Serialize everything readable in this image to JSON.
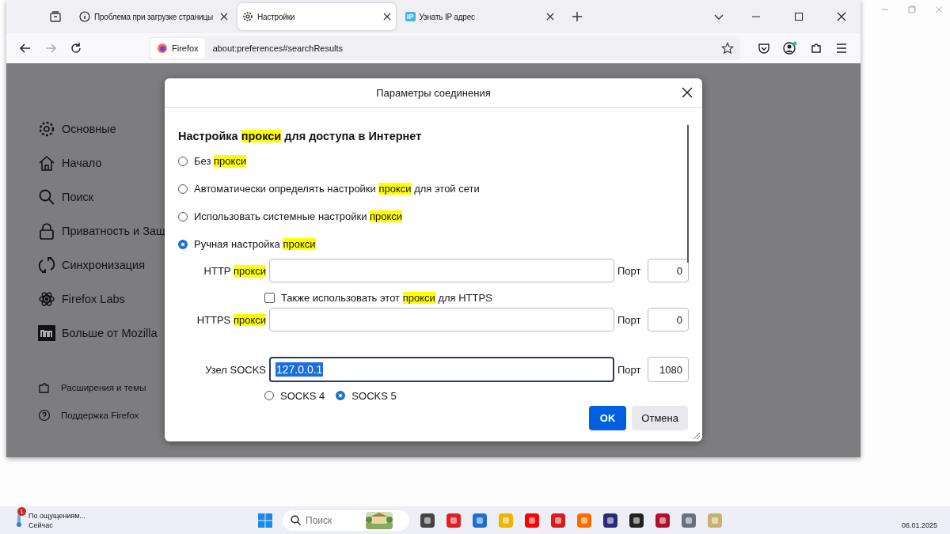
{
  "tabs": [
    {
      "title": "Проблема при загрузке страницы",
      "selected": false
    },
    {
      "title": "Настройки",
      "selected": true
    },
    {
      "badge": "IP",
      "title": "Узнать IP адрес",
      "selected": false
    }
  ],
  "address_bar": {
    "identity": "Firefox",
    "url": "about:preferences#searchResults"
  },
  "sidebar": {
    "items": [
      {
        "label": "Основные"
      },
      {
        "label": "Начало"
      },
      {
        "label": "Поиск"
      },
      {
        "label": "Приватность и Защ"
      },
      {
        "label": "Синхронизация"
      },
      {
        "label": "Firefox Labs"
      },
      {
        "label": "Больше от Mozilla"
      }
    ],
    "footer": [
      {
        "label": "Расширения и темы"
      },
      {
        "label": "Поддержка Firefox"
      }
    ]
  },
  "dialog": {
    "title": "Параметры соединения",
    "heading": [
      {
        "text": "Настройка ",
        "highlighted": false
      },
      {
        "text": "прокси",
        "highlighted": true
      },
      {
        "text": " для доступа в Интернет",
        "highlighted": false
      }
    ],
    "proxy_modes": [
      {
        "selected": false,
        "label": [
          {
            "text": "Без ",
            "highlighted": false
          },
          {
            "text": "прокси",
            "highlighted": true
          }
        ]
      },
      {
        "selected": false,
        "label": [
          {
            "text": "Автоматически определять настройки ",
            "highlighted": false
          },
          {
            "text": "прокси",
            "highlighted": true
          },
          {
            "text": " для этой сети",
            "highlighted": false
          }
        ]
      },
      {
        "selected": false,
        "label": [
          {
            "text": "Использовать системные настройки ",
            "highlighted": false
          },
          {
            "text": "прокси",
            "highlighted": true
          }
        ]
      },
      {
        "selected": true,
        "label": [
          {
            "text": "Ручная настройка ",
            "highlighted": false
          },
          {
            "text": "прокси",
            "highlighted": true
          }
        ]
      }
    ],
    "http": {
      "label": [
        {
          "text": "HTTP ",
          "highlighted": false
        },
        {
          "text": "прокси",
          "highlighted": true
        }
      ],
      "port_label": "Порт",
      "port": "0"
    },
    "also_https": {
      "checked": false,
      "label": [
        {
          "text": "Также использовать этот ",
          "highlighted": false
        },
        {
          "text": "прокси",
          "highlighted": true
        },
        {
          "text": " для HTTPS",
          "highlighted": false
        }
      ]
    },
    "https": {
      "label": [
        {
          "text": "HTTPS ",
          "highlighted": false
        },
        {
          "text": "прокси",
          "highlighted": true
        }
      ],
      "port_label": "Порт",
      "port": "0"
    },
    "socks": {
      "label": "Узел SOCKS",
      "value": "127.0.0.1",
      "value_selected": true,
      "port_label": "Порт",
      "port": "1080"
    },
    "socks_versions": [
      {
        "label": "SOCKS 4",
        "selected": false
      },
      {
        "label": "SOCKS 5",
        "selected": true
      }
    ],
    "buttons": [
      {
        "label": "OK",
        "default": true
      },
      {
        "label": "Отмена",
        "default": false
      }
    ]
  },
  "taskbar": {
    "notification": {
      "badge": "1",
      "title": "По ощущениям...",
      "time": "Сейчас"
    },
    "search": {
      "placeholder": "Поиск"
    },
    "date": "06.01.2025"
  }
}
